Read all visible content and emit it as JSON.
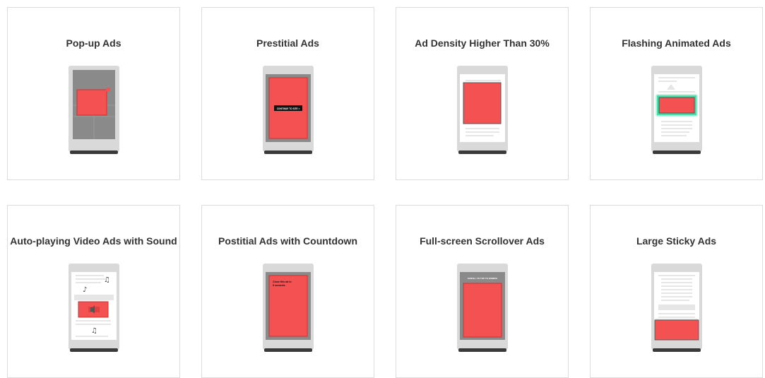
{
  "cards": [
    {
      "title": "Pop-up Ads",
      "icon": "popup-ad-illustration"
    },
    {
      "title": "Prestitial Ads",
      "icon": "prestitial-ad-illustration",
      "ad_text": "CONTINUE TO SITE >"
    },
    {
      "title": "Ad Density Higher Than 30%",
      "icon": "ad-density-illustration"
    },
    {
      "title": "Flashing Animated Ads",
      "icon": "flashing-ad-illustration"
    },
    {
      "title": "Auto-playing Video Ads with Sound",
      "icon": "autoplay-video-ad-illustration"
    },
    {
      "title": "Postitial Ads with Countdown",
      "icon": "postitial-ad-illustration",
      "ad_text_line1": "Close this ad in",
      "ad_text_line2": "5 seconds"
    },
    {
      "title": "Full-screen Scrollover Ads",
      "icon": "scrollover-ad-illustration",
      "ad_text": "SCROLL TO TOP TO DISMISS"
    },
    {
      "title": "Large Sticky Ads",
      "icon": "sticky-ad-illustration"
    }
  ],
  "colors": {
    "ad_red": "#f45252",
    "phone_body": "#d9d9d9",
    "phone_base": "#3a3a3a",
    "screen": "#ffffff",
    "overlay": "#8a8a8a",
    "content_line": "#e6e6e6",
    "flash_glow": "#40e0a8"
  }
}
